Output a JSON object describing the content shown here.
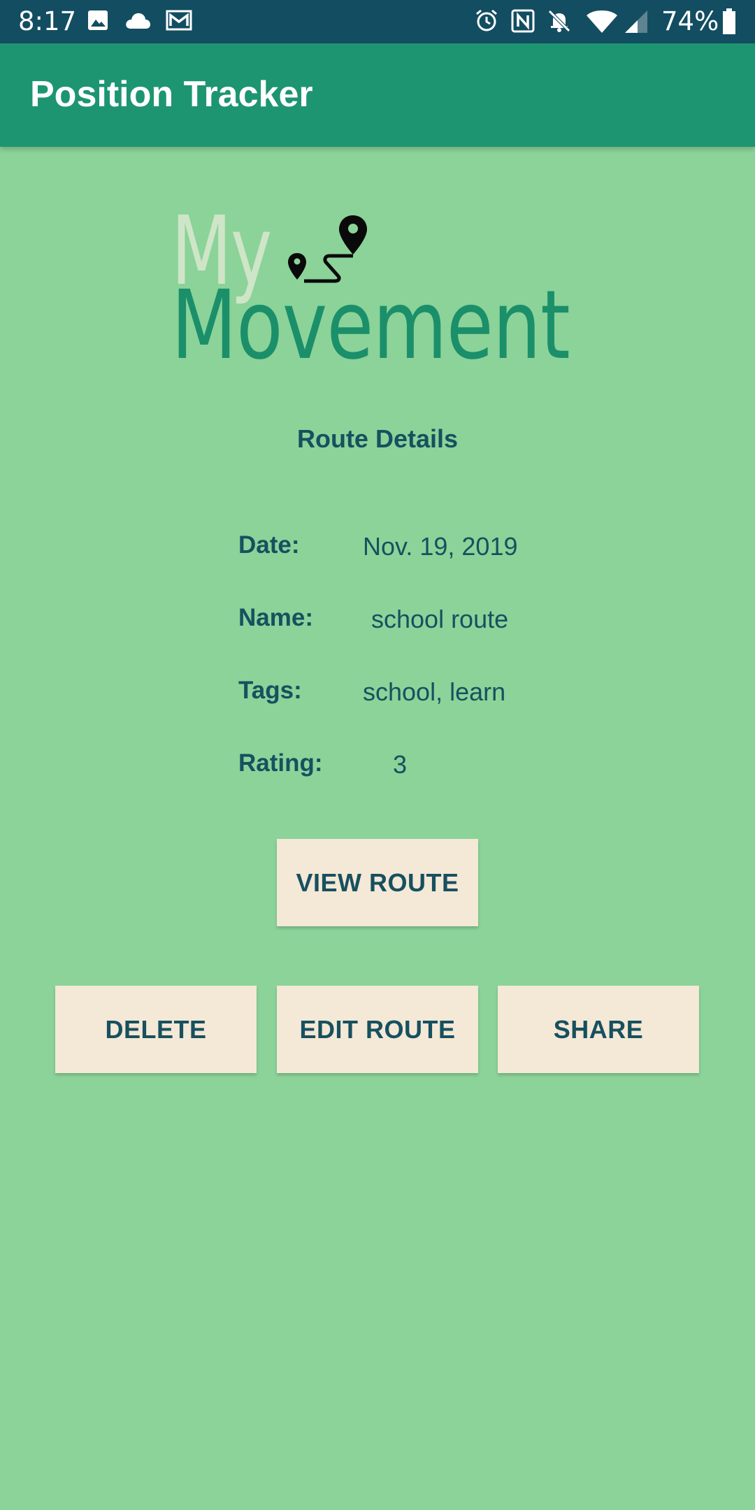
{
  "status_bar": {
    "time": "8:17",
    "battery_percent": "74%",
    "icons": [
      "image-icon",
      "cloud-icon",
      "gmail-icon",
      "alarm-icon",
      "nfc-icon",
      "notifications-off-icon",
      "wifi-icon",
      "signal-icon",
      "battery-icon"
    ]
  },
  "app_bar": {
    "title": "Position Tracker"
  },
  "logo": {
    "line1": "My",
    "line2": "Movement",
    "icon": "route-pins-icon"
  },
  "section_title": "Route Details",
  "details": {
    "date_label": "Date:",
    "date_value": "Nov. 19, 2019",
    "name_label": "Name:",
    "name_value": "school route",
    "tags_label": "Tags:",
    "tags_value": "school, learn",
    "rating_label": "Rating:",
    "rating_value": "3"
  },
  "buttons": {
    "view_route": "VIEW ROUTE",
    "delete": "DELETE",
    "edit_route": "EDIT ROUTE",
    "share": "SHARE"
  },
  "colors": {
    "background": "#8bd399",
    "app_bar": "#1d9570",
    "status_bar": "#134d61",
    "text": "#17505f",
    "button": "#f4e8d6"
  }
}
